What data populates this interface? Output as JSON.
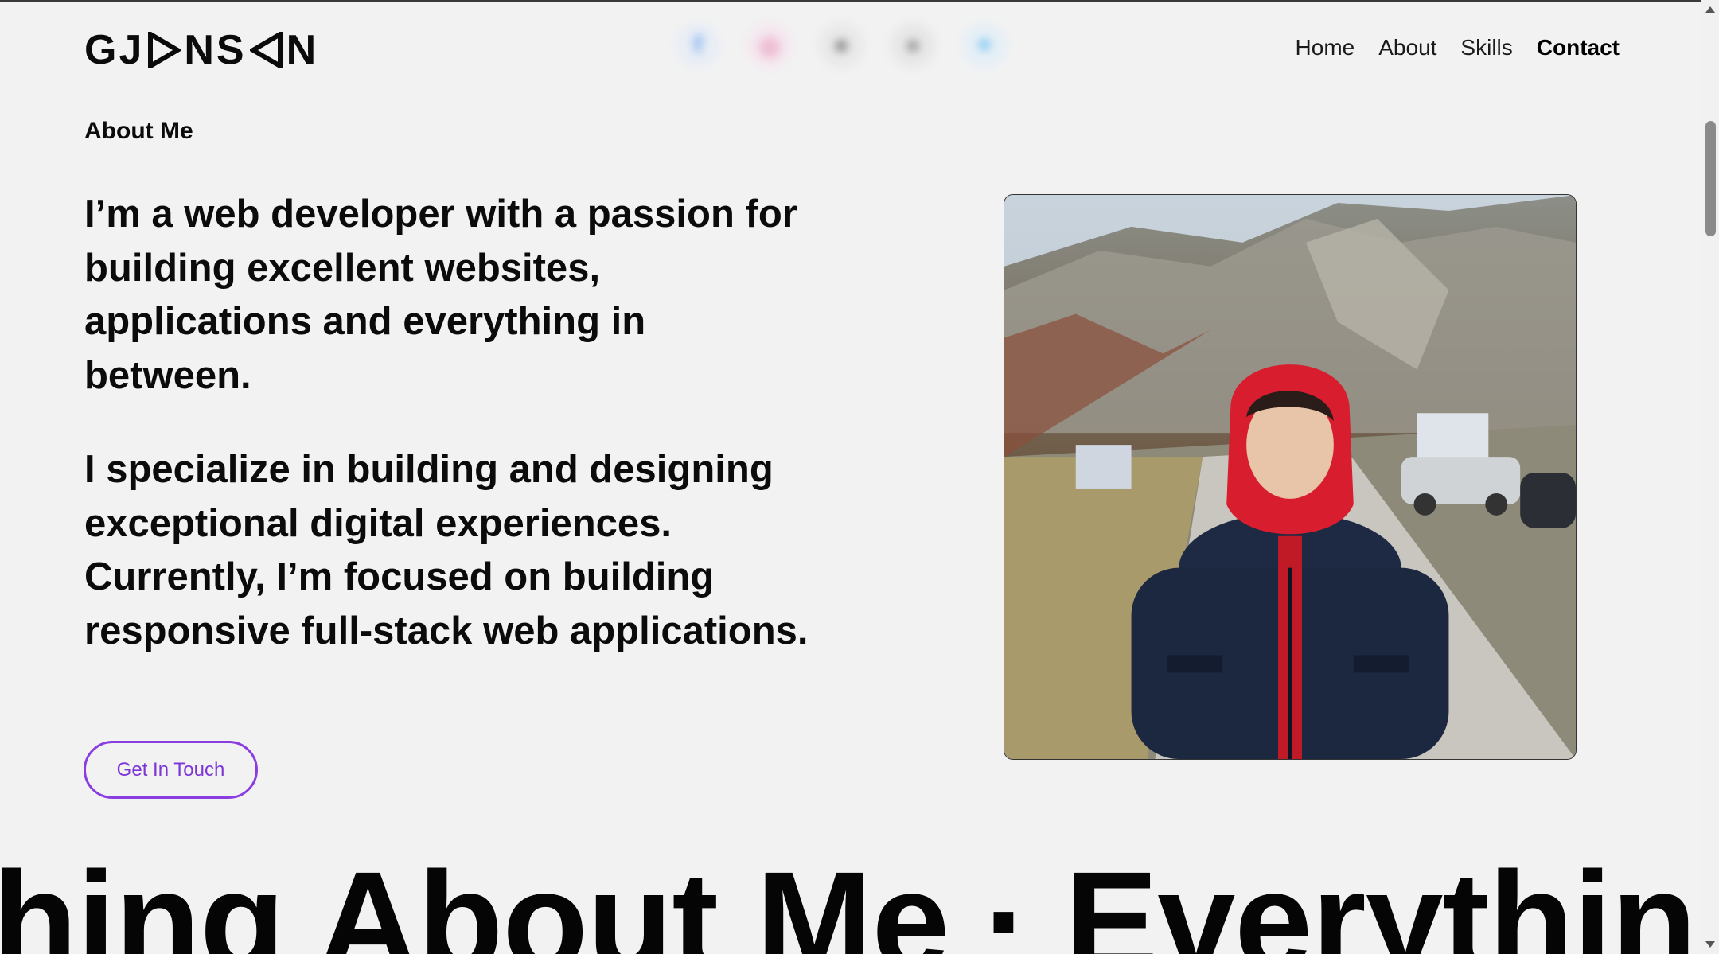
{
  "header": {
    "logo_text_left": "GJ",
    "logo_text_mid": "NS",
    "logo_text_right": "N",
    "socials": [
      {
        "icon": "facebook-icon",
        "glyph": "f",
        "color": "#1877f2"
      },
      {
        "icon": "instagram-icon",
        "glyph": "◎",
        "color": "#d62976"
      },
      {
        "icon": "github-icon",
        "glyph": "●",
        "color": "#333333"
      },
      {
        "icon": "globe-icon",
        "glyph": "●",
        "color": "#555555"
      },
      {
        "icon": "twitter-icon",
        "glyph": "✦",
        "color": "#1da1f2"
      }
    ],
    "nav": [
      {
        "label": "Home"
      },
      {
        "label": "About"
      },
      {
        "label": "Skills"
      },
      {
        "label": "Contact"
      }
    ]
  },
  "about": {
    "label": "About Me",
    "paragraph_1": "I’m a web developer with a passion for building excellent websites, applications and everything in between.",
    "paragraph_2": "I specialize in building and designing exceptional digital experiences. Currently, I’m focused on building responsive full-stack web applications.",
    "cta": "Get In Touch",
    "accent_color": "#8a3ee0"
  },
  "marquee": {
    "left_fragment": "hing About Me",
    "separator": "·",
    "right_fragment": "Everything Ab"
  }
}
